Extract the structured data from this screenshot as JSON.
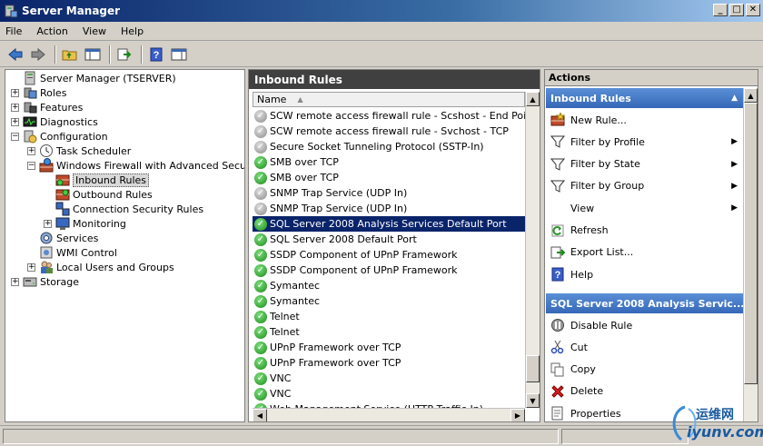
{
  "window": {
    "title": "Server Manager"
  },
  "menu": [
    "File",
    "Action",
    "View",
    "Help"
  ],
  "tree": [
    {
      "label": "Server Manager (TSERVER)",
      "level": 0,
      "expander": "",
      "icon": "server-icon"
    },
    {
      "label": "Roles",
      "level": 0,
      "expander": "+",
      "icon": "roles-icon"
    },
    {
      "label": "Features",
      "level": 0,
      "expander": "+",
      "icon": "features-icon"
    },
    {
      "label": "Diagnostics",
      "level": 0,
      "expander": "+",
      "icon": "diagnostics-icon"
    },
    {
      "label": "Configuration",
      "level": 0,
      "expander": "−",
      "icon": "configuration-icon"
    },
    {
      "label": "Task Scheduler",
      "level": 1,
      "expander": "+",
      "icon": "clock-icon"
    },
    {
      "label": "Windows Firewall with Advanced Security",
      "level": 1,
      "expander": "−",
      "icon": "firewall-icon"
    },
    {
      "label": "Inbound Rules",
      "level": 2,
      "expander": "",
      "icon": "inbound-rules-icon",
      "selected": true
    },
    {
      "label": "Outbound Rules",
      "level": 2,
      "expander": "",
      "icon": "outbound-rules-icon"
    },
    {
      "label": "Connection Security Rules",
      "level": 2,
      "expander": "",
      "icon": "connection-security-icon"
    },
    {
      "label": "Monitoring",
      "level": 2,
      "expander": "+",
      "icon": "monitoring-icon"
    },
    {
      "label": "Services",
      "level": 1,
      "expander": "",
      "icon": "services-icon"
    },
    {
      "label": "WMI Control",
      "level": 1,
      "expander": "",
      "icon": "wmi-icon"
    },
    {
      "label": "Local Users and Groups",
      "level": 1,
      "expander": "+",
      "icon": "users-icon"
    },
    {
      "label": "Storage",
      "level": 0,
      "expander": "+",
      "icon": "storage-icon"
    }
  ],
  "middle": {
    "title": "Inbound Rules",
    "column": "Name",
    "rules": [
      {
        "name": "SCW remote access firewall rule - Scshost - End Point RPC",
        "enabled": false
      },
      {
        "name": "SCW remote access firewall rule - Svchost - TCP",
        "enabled": false
      },
      {
        "name": "Secure Socket Tunneling Protocol (SSTP-In)",
        "enabled": false
      },
      {
        "name": "SMB over TCP",
        "enabled": true
      },
      {
        "name": "SMB over TCP",
        "enabled": true
      },
      {
        "name": "SNMP Trap Service (UDP In)",
        "enabled": false
      },
      {
        "name": "SNMP Trap Service (UDP In)",
        "enabled": false
      },
      {
        "name": "SQL Server 2008 Analysis Services Default Port",
        "enabled": true,
        "selected": true
      },
      {
        "name": "SQL Server 2008 Default Port",
        "enabled": true
      },
      {
        "name": "SSDP Component of UPnP Framework",
        "enabled": true
      },
      {
        "name": "SSDP Component of UPnP Framework",
        "enabled": true
      },
      {
        "name": "Symantec",
        "enabled": true
      },
      {
        "name": "Symantec",
        "enabled": true
      },
      {
        "name": "Telnet",
        "enabled": true
      },
      {
        "name": "Telnet",
        "enabled": true
      },
      {
        "name": "UPnP Framework over TCP",
        "enabled": true
      },
      {
        "name": "UPnP Framework over TCP",
        "enabled": true
      },
      {
        "name": "VNC",
        "enabled": true
      },
      {
        "name": "VNC",
        "enabled": true
      },
      {
        "name": "Web Management Service (HTTP Traffic-In)",
        "enabled": true
      }
    ]
  },
  "actions": {
    "title": "Actions",
    "section1": {
      "title": "Inbound Rules",
      "items": [
        {
          "label": "New Rule...",
          "icon": "new-rule-icon",
          "submenu": false
        },
        {
          "label": "Filter by Profile",
          "icon": "filter-icon",
          "submenu": true
        },
        {
          "label": "Filter by State",
          "icon": "filter-icon",
          "submenu": true
        },
        {
          "label": "Filter by Group",
          "icon": "filter-icon",
          "submenu": true
        },
        {
          "label": "View",
          "icon": "",
          "submenu": true
        },
        {
          "label": "Refresh",
          "icon": "refresh-icon",
          "submenu": false
        },
        {
          "label": "Export List...",
          "icon": "export-icon",
          "submenu": false
        },
        {
          "label": "Help",
          "icon": "help-icon",
          "submenu": false
        }
      ]
    },
    "section2": {
      "title": "SQL Server 2008 Analysis Servic...",
      "items": [
        {
          "label": "Disable Rule",
          "icon": "disable-rule-icon"
        },
        {
          "label": "Cut",
          "icon": "cut-icon"
        },
        {
          "label": "Copy",
          "icon": "copy-icon"
        },
        {
          "label": "Delete",
          "icon": "delete-icon"
        },
        {
          "label": "Properties",
          "icon": "properties-icon"
        }
      ]
    }
  },
  "watermark": {
    "line1": "运维网",
    "line2": "iyunv.com"
  },
  "colors": {
    "selection": "#0a246a",
    "section_header": "#3568b7",
    "enabled": "#1a8a1a"
  }
}
